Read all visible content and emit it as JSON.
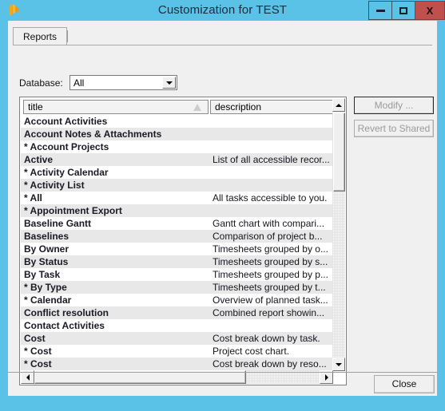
{
  "window": {
    "title": "Customization for TEST",
    "app_icon": "app-logo-icon",
    "colors": {
      "titlebar": "#5bc2e7",
      "close_button": "#c0504d",
      "client": "#f0f0f0",
      "row_alt": "#e8e8e8"
    },
    "controls": {
      "minimize_label": "Minimize",
      "maximize_label": "Maximize",
      "close_label": "X"
    }
  },
  "tabs": [
    {
      "label": "Reports",
      "selected": true
    }
  ],
  "filter": {
    "database_label": "Database:",
    "database_value": "All",
    "database_placeholder": "All"
  },
  "grid": {
    "columns": [
      {
        "key": "title",
        "label": "title",
        "sort": "ascending"
      },
      {
        "key": "description",
        "label": "description",
        "sort": "none"
      }
    ],
    "rows": [
      {
        "title": "Account Activities",
        "description": ""
      },
      {
        "title": "Account Notes & Attachments",
        "description": ""
      },
      {
        "title": "* Account Projects",
        "description": ""
      },
      {
        "title": "Active",
        "description": "List of all accessible recor..."
      },
      {
        "title": "* Activity Calendar",
        "description": ""
      },
      {
        "title": "* Activity List",
        "description": ""
      },
      {
        "title": "* All",
        "description": "All tasks accessible to you."
      },
      {
        "title": "* Appointment Export",
        "description": ""
      },
      {
        "title": "Baseline Gantt",
        "description": "Gantt chart with compari..."
      },
      {
        "title": "Baselines",
        "description": "Comparison of project b..."
      },
      {
        "title": "By Owner",
        "description": "Timesheets grouped by o..."
      },
      {
        "title": "By Status",
        "description": "Timesheets grouped by s..."
      },
      {
        "title": "By Task",
        "description": "Timesheets grouped by p..."
      },
      {
        "title": "* By Type",
        "description": "Timesheets grouped by t..."
      },
      {
        "title": "* Calendar",
        "description": "Overview of planned task..."
      },
      {
        "title": "Conflict resolution",
        "description": "Combined report showin..."
      },
      {
        "title": "Contact Activities",
        "description": ""
      },
      {
        "title": "Cost",
        "description": "Cost break down by task."
      },
      {
        "title": "* Cost",
        "description": "Project cost chart."
      },
      {
        "title": "* Cost",
        "description": "Cost break down by reso..."
      }
    ]
  },
  "actions": {
    "modify_label": "Modify ...",
    "revert_label": "Revert to Shared",
    "close_label": "Close"
  },
  "scrollbars": {
    "vertical": {
      "up_icon": "arrow-up-icon",
      "down_icon": "arrow-down-icon"
    },
    "horizontal": {
      "left_icon": "arrow-left-icon",
      "right_icon": "arrow-right-icon"
    }
  }
}
